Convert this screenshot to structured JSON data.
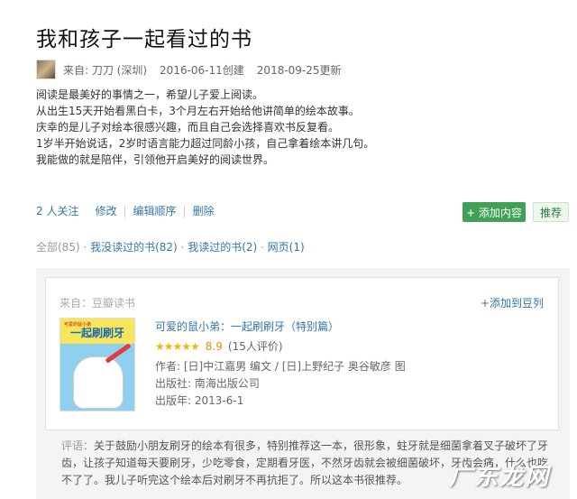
{
  "page": {
    "title": "我和孩子一起看过的书"
  },
  "meta": {
    "author_prefix": "来自: 刀刀 (深圳)",
    "created": "2016-06-11创建",
    "updated": "2018-09-25更新"
  },
  "intro": [
    "阅读是最美好的事情之一，希望儿子爱上阅读。",
    "从出生15天开始看黑白卡，3个月左右开始给他讲简单的绘本故事。",
    "庆幸的是儿子对绘本很感兴趣，而且自己会选择喜欢书反复看。",
    "1岁半开始说话，2岁时语言能力超过同龄小孩，自己拿着绘本讲几句。",
    "我能做的就是陪伴，引领他开启美好的阅读世界。"
  ],
  "actions": {
    "follow": "2 人关注",
    "edit": "修改",
    "reorder": "编辑顺序",
    "delete": "删除",
    "add_content": "+ 添加内容",
    "recommend": "推荐"
  },
  "filters": {
    "all": "全部(85)",
    "unread": "我没读过的书(82)",
    "read": "我读过的书(2)",
    "web": "网页(1)"
  },
  "item": {
    "source": "来自：豆瓣读书",
    "add_to_list": "+添加到豆列",
    "cover": {
      "small_text": "可爱的鼠小弟",
      "big_text": "一起刷刷牙"
    },
    "book_title": "可爱的鼠小弟：一起刷刷牙（特别篇）",
    "stars": "★★★★★",
    "score": "8.9",
    "rating_count": "(15人评价)",
    "author_label": "作者:",
    "authors": "[日]中江嘉男 编文 / [日]上野纪子 奥谷敏彦 图",
    "publisher": "出版社: 南海出版公司",
    "pub_year": "出版年: 2013-6-1",
    "comment_label": "评语：",
    "comment": "关于鼓励小朋友刷牙的绘本有很多，特别推荐这一本，很形象，蛀牙就是细菌拿着叉子破坏了牙齿，让孩子知道每天要刷牙，少吃零食，定期看牙医，不然牙齿就会被细菌破坏，牙齿会痛，什么也吃不了了。我儿子听完这个绘本后对刷牙不再抗拒了。所以这本书很推荐。"
  },
  "watermark": "广东龙网"
}
